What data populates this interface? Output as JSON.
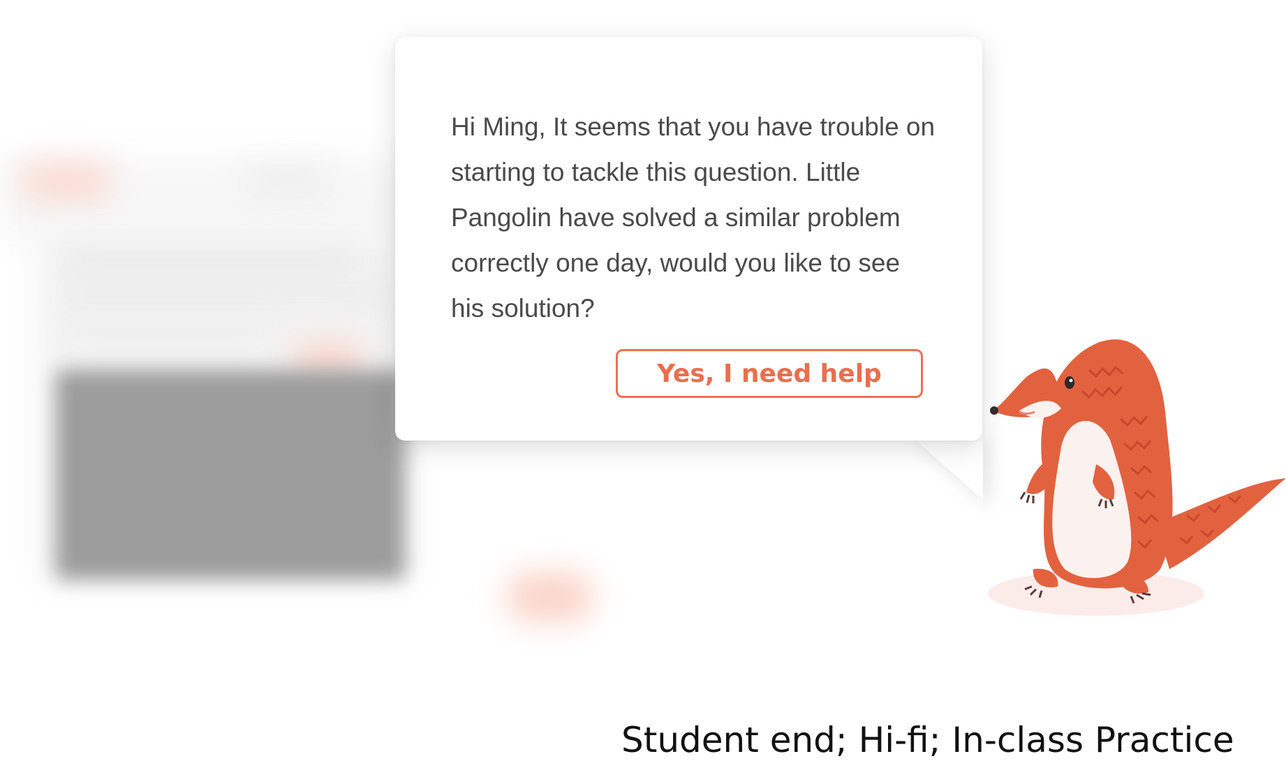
{
  "dialog": {
    "message": "Hi Ming, It seems that you have trouble on starting to tackle this question. Little Pangolin have solved a similar problem correctly one day, would you like to see his solution?",
    "help_button_label": "Yes, I need help"
  },
  "mascot": {
    "icon": "pangolin-mascot-icon"
  },
  "caption": {
    "text": "Student end; Hi-fi; In-class Practice"
  },
  "colors": {
    "accent": "#ea7251",
    "message_text": "#4a4a4a",
    "pangolin_body": "#e2623f",
    "pangolin_belly": "#fbf1ee"
  }
}
